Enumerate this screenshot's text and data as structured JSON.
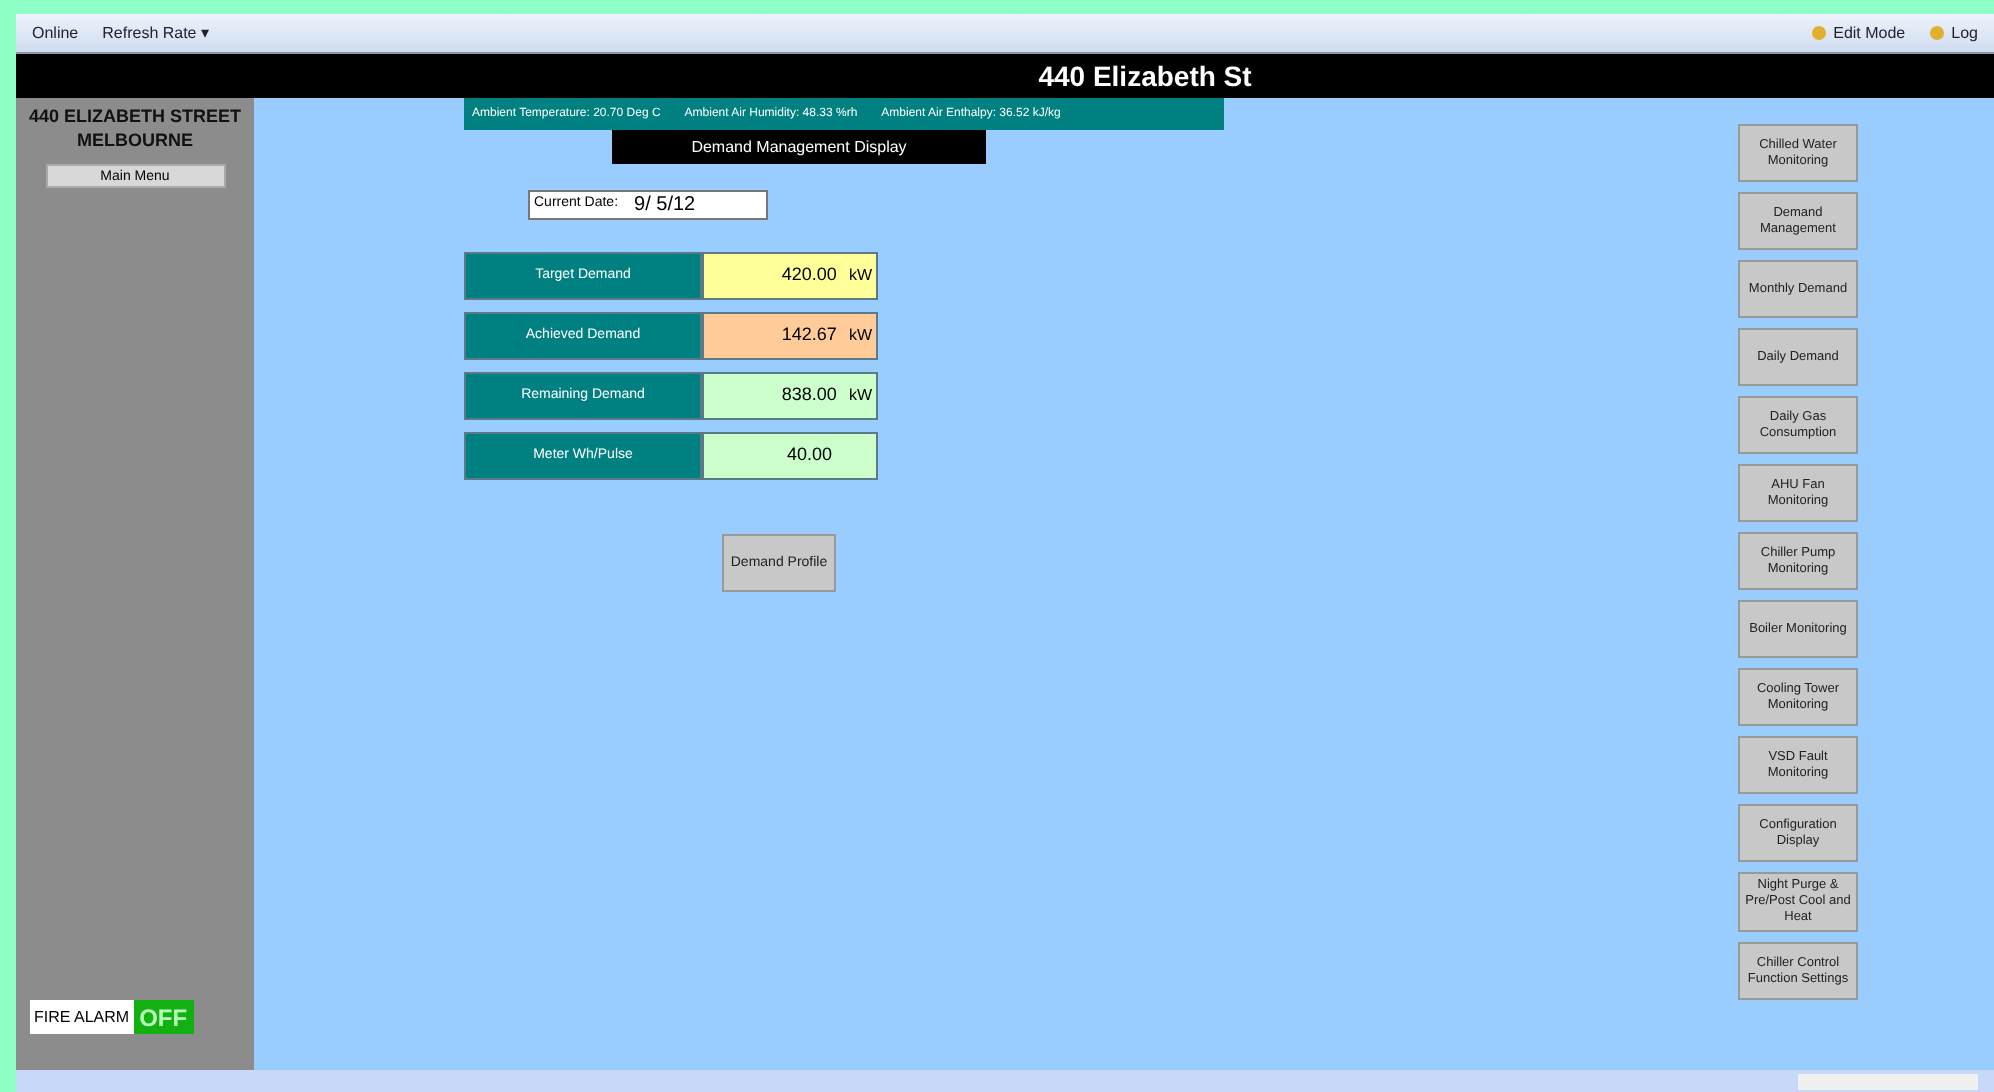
{
  "toolbar": {
    "left": [
      "Online",
      "Refresh Rate ▾"
    ],
    "right": [
      "Edit Mode",
      "Log"
    ]
  },
  "window": {
    "title": "440 Elizabeth St"
  },
  "sidebar": {
    "site": "440 ELIZABETH STREET MELBOURNE",
    "menu_button": "Main Menu",
    "fire_alarm": {
      "label": "FIRE ALARM",
      "value": "OFF",
      "on": false
    }
  },
  "ambient": [
    "Ambient Temperature: 20.70 Deg C",
    "Ambient Air Humidity: 48.33 %rh",
    "Ambient Air Enthalpy: 36.52 kJ/kg"
  ],
  "display_title": "Demand Management Display",
  "current_date": {
    "label": "Current Date:",
    "value": "9/ 5/12"
  },
  "readings": [
    {
      "label": "Target Demand",
      "value": "420.00",
      "unit": "kW",
      "color": "#ffff99"
    },
    {
      "label": "Achieved Demand",
      "value": "142.67",
      "unit": "kW",
      "color": "#ffcc99"
    },
    {
      "label": "Remaining Demand",
      "value": "838.00",
      "unit": "kW",
      "color": "#ccffcc"
    },
    {
      "label": "Meter Wh/Pulse",
      "value": "40.00",
      "color": "#ccffcc"
    }
  ],
  "profile_button": "Demand Profile",
  "nav_buttons": [
    "Chilled Water Monitoring",
    "Demand Management",
    "Monthly Demand",
    "Daily Demand",
    "Daily Gas Consumption",
    "AHU Fan Monitoring",
    "Chiller Pump Monitoring",
    "Boiler Monitoring",
    "Cooling Tower Monitoring",
    "VSD Fault Monitoring",
    "Configuration Display",
    "Night Purge & Pre/Post Cool and Heat",
    "Chiller Control Function Settings"
  ]
}
